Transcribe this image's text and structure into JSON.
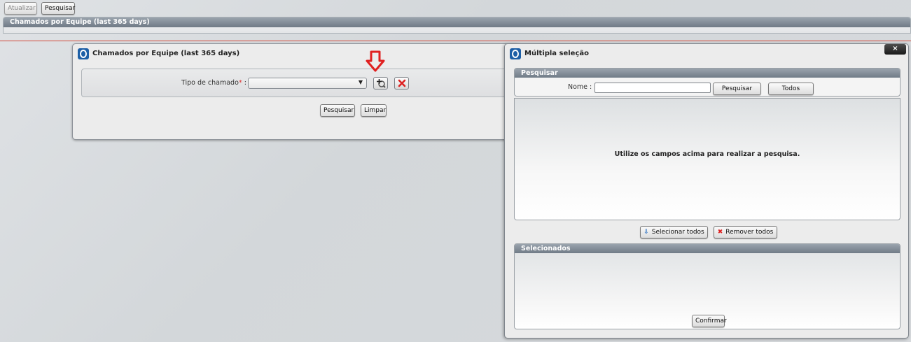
{
  "toolbar": {
    "atualizar_label": "Atualizar",
    "pesquisar_label": "Pesquisar"
  },
  "main": {
    "header_title": "Chamados por Equipe (last 365 days)"
  },
  "form_panel": {
    "title": "Chamados por Equipe (last 365 days)",
    "tipo_label": "Tipo de chamado",
    "required_mark": "*",
    "colon": ":",
    "tipo_value": "",
    "select_arrow": "▼",
    "add_icon": "search-add-icon",
    "clear_icon": "delete-icon",
    "pesquisar_label": "Pesquisar",
    "limpar_label": "Limpar",
    "marker_color": "#e02020"
  },
  "modal": {
    "title": "Múltipla seleção",
    "close_label": "×",
    "search_section_title": "Pesquisar",
    "nome_label": "Nome :",
    "nome_value": "",
    "pesquisar_label": "Pesquisar",
    "todos_label": "Todos",
    "results_message": "Utilize os campos acima para realizar a pesquisa.",
    "selecionar_todos_label": "Selecionar todos",
    "remover_todos_label": "Remover todos",
    "selecionados_title": "Selecionados",
    "confirmar_label": "Confirmar"
  },
  "colors": {
    "header_bar": "#7d8792",
    "accent_blue": "#1d5fa6",
    "danger_red": "#d22222"
  }
}
